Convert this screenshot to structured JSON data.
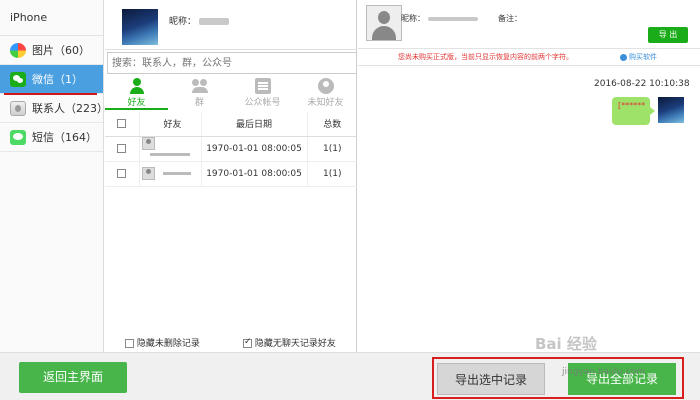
{
  "sidebar": {
    "header": "iPhone",
    "items": [
      {
        "label": "图片（60）",
        "icon": "photos-icon",
        "active": false
      },
      {
        "label": "微信（1）",
        "icon": "wechat-icon",
        "active": true
      },
      {
        "label": "联系人（223）",
        "icon": "contacts-icon",
        "active": false
      },
      {
        "label": "短信（164）",
        "icon": "messages-icon",
        "active": false
      }
    ]
  },
  "profile": {
    "nickname_label": "昵称："
  },
  "search": {
    "placeholder": "搜索：联系人，群，公众号"
  },
  "tabs": [
    {
      "label": "好友",
      "icon": "person-icon",
      "active": true
    },
    {
      "label": "群",
      "icon": "group-icon",
      "active": false
    },
    {
      "label": "公众帐号",
      "icon": "official-account-icon",
      "active": false
    },
    {
      "label": "未知好友",
      "icon": "unknown-friend-icon",
      "active": false
    }
  ],
  "table": {
    "headers": [
      "",
      "好友",
      "最后日期",
      "总数"
    ],
    "rows": [
      {
        "date": "1970-01-01 08:00:05",
        "count": "1(1)"
      },
      {
        "date": "1970-01-01 08:00:05",
        "count": "1(1)"
      }
    ]
  },
  "options": {
    "hide_deleted": "隐藏未删除记录",
    "hide_no_chat": "隐藏无聊天记录好友",
    "hide_deleted_checked": false,
    "hide_no_chat_checked": true
  },
  "chat": {
    "nickname_label": "昵称：",
    "note_label": "备注：",
    "export_label": "导 出",
    "notice": "您尚未购买正式版，当前只显示恢复内容的前两个字符。",
    "buy_label": "购买软件",
    "timestamp": "2016-08-22 10:10:38",
    "message": "[******"
  },
  "footer": {
    "back_label": "返回主界面",
    "export_selected_label": "导出选中记录",
    "export_all_label": "导出全部记录"
  },
  "watermark": {
    "text": "Bai 经验",
    "sub": "jingyan.baidu.com"
  },
  "colors": {
    "accent_green": "#1aad19",
    "active_blue": "#4a9fe0",
    "alert_red": "#d81e1e"
  }
}
